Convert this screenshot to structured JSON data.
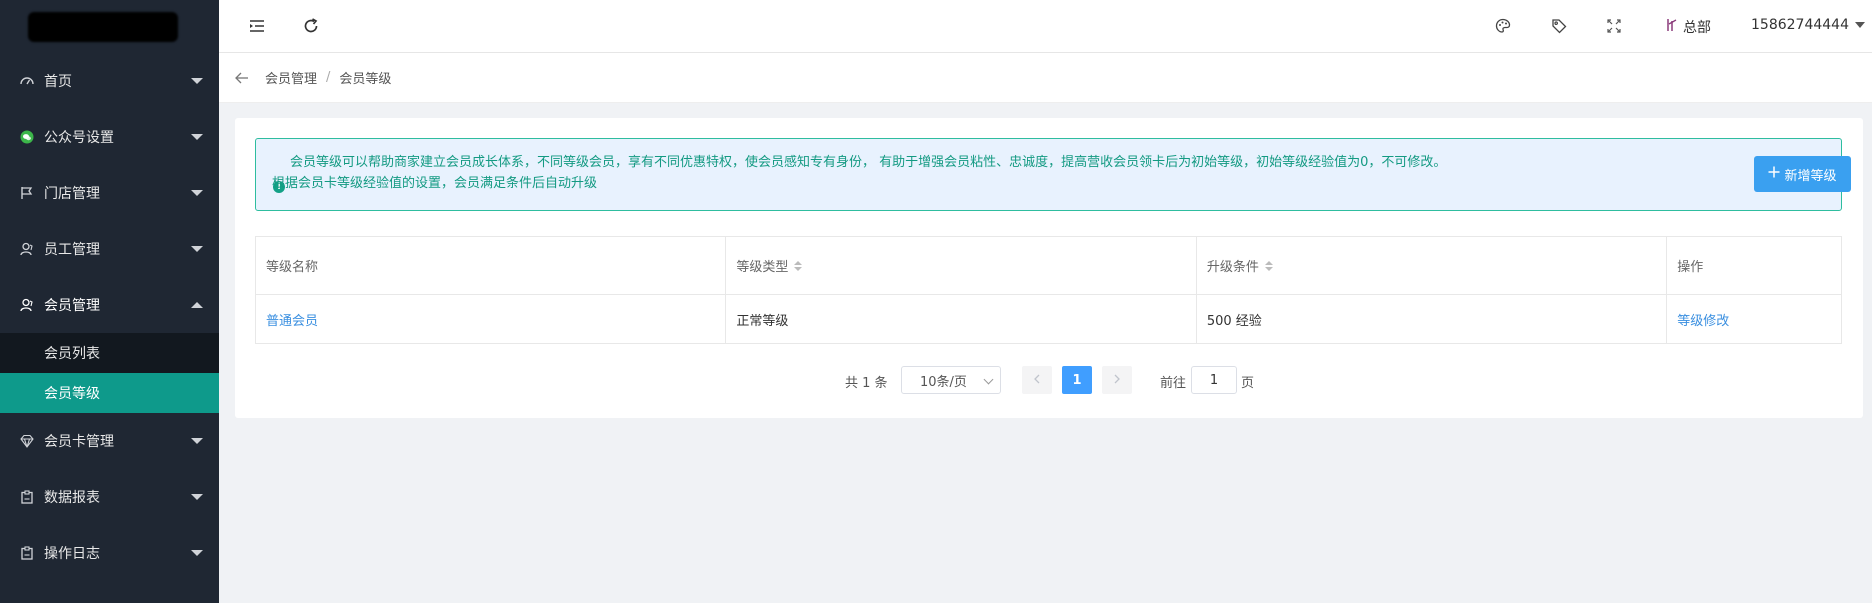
{
  "sidebar": {
    "menu": [
      {
        "label": "首页",
        "icon": "dashboard-icon"
      },
      {
        "label": "公众号设置",
        "icon": "wechat-icon"
      },
      {
        "label": "门店管理",
        "icon": "flag-icon"
      },
      {
        "label": "员工管理",
        "icon": "staff-icon"
      },
      {
        "label": "会员管理",
        "icon": "member-icon",
        "open": true
      },
      {
        "label": "会员卡管理",
        "icon": "diamond-icon"
      },
      {
        "label": "数据报表",
        "icon": "report-icon"
      },
      {
        "label": "操作日志",
        "icon": "log-icon"
      }
    ],
    "submenu": [
      {
        "label": "会员列表",
        "active": false
      },
      {
        "label": "会员等级",
        "active": true
      }
    ]
  },
  "topbar": {
    "org": "总部",
    "user": "15862744444",
    "icons": [
      "collapse-menu-icon",
      "refresh-icon",
      "palette-icon",
      "tag-icon",
      "fullscreen-icon"
    ]
  },
  "breadcrumb": {
    "items": [
      "会员管理",
      "会员等级"
    ],
    "separator": "/"
  },
  "notice": {
    "text": "会员等级可以帮助商家建立会员成长体系，不同等级会员，享有不同优惠特权，使会员感知专有身份， 有助于增强会员粘性、忠诚度，提高营收会员领卡后为初始等级，初始等级经验值为0，不可修改。 根据会员卡等级经验值的设置，会员满足条件后自动升级",
    "add_button": "新增等级"
  },
  "table": {
    "headers": [
      "等级名称",
      "等级类型",
      "升级条件",
      "操作"
    ],
    "rows": [
      {
        "name": "普通会员",
        "type": "正常等级",
        "condition": "500 经验",
        "action": "等级修改"
      }
    ]
  },
  "pagination": {
    "total": "共 1 条",
    "page_size": "10条/页",
    "current_page": "1",
    "goto_label": "前往",
    "goto_value": "1",
    "page_unit": "页"
  },
  "colors": {
    "sidebar_bg": "#1f2733",
    "active_item": "#0e9a8b",
    "primary": "#409eff",
    "notice_text": "#139a82"
  }
}
